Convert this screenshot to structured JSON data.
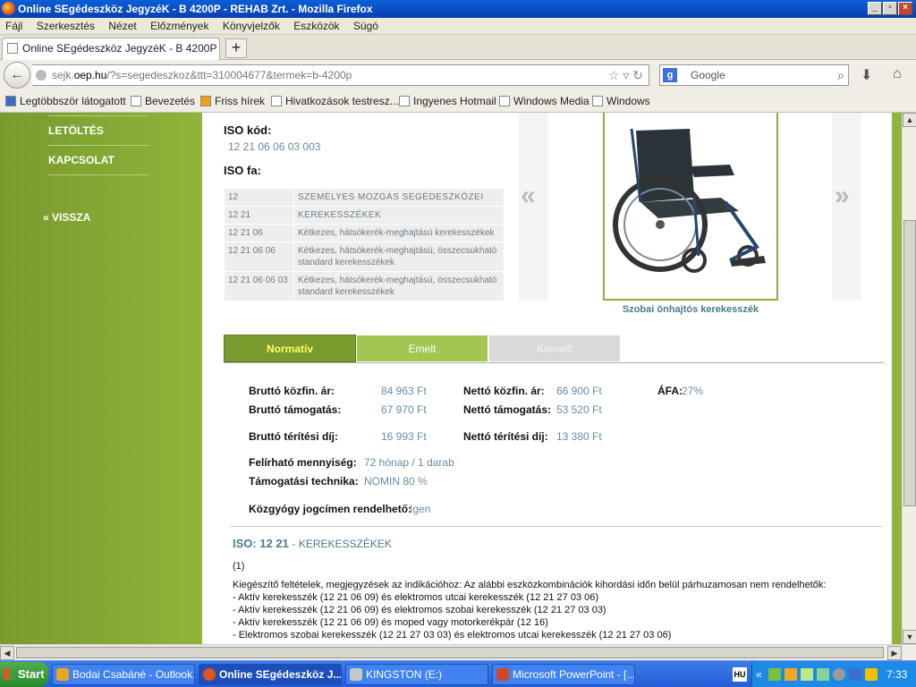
{
  "window": {
    "title": "Online SEgédeszköz JegyzéK - B 4200P - REHAB Zrt. - Mozilla Firefox"
  },
  "menu": [
    "Fájl",
    "Szerkesztés",
    "Nézet",
    "Előzmények",
    "Könyvjelzők",
    "Eszközök",
    "Súgó"
  ],
  "browser_tab": {
    "title": "Online SEgédeszköz JegyzéK - B 4200P - RE...",
    "new_tab": "+"
  },
  "address": {
    "prefix": "sejk.",
    "domain": "oep.hu",
    "path": "/?s=segedeszkoz&ttt=310004677&termek=b-4200p"
  },
  "search": {
    "placeholder": "Google",
    "engine_icon": "g-icon"
  },
  "bookmarks": [
    "Legtöbbször látogatott",
    "Bevezetés",
    "Friss hírek",
    "Hivatkozások testresz...",
    "Ingyenes Hotmail",
    "Windows Media",
    "Windows"
  ],
  "sidebar": {
    "items": [
      "LETÖLTÉS",
      "KAPCSOLAT"
    ],
    "back": "« VISSZA"
  },
  "iso": {
    "code_label": "ISO kód:",
    "code_value": "12 21 06 06 03 003",
    "tree_label": "ISO fa:",
    "tree": [
      {
        "code": "12",
        "name": "SZEMÉLYES MOZGÁS SEGÉDESZKÖZEI"
      },
      {
        "code": "12 21",
        "name": "KEREKESSZÉKEK"
      },
      {
        "code": "12 21 06",
        "name": "Kétkezes, hátsókerék-meghajtású kerekesszékek"
      },
      {
        "code": "12 21 06 06",
        "name": "Kétkezes, hátsókerék-meghajtású, összecsukható standard kerekesszékek"
      },
      {
        "code": "12 21 06 06 03",
        "name": "Kétkezes, hátsókerék-meghajtású, összecsukható standard kerekesszékek"
      }
    ]
  },
  "product": {
    "caption": "Szobai önhajtós kerekesszék",
    "prev": "«",
    "next": "»"
  },
  "price_tabs": [
    "Normatív",
    "Emelt",
    "Kiemelt"
  ],
  "prices": {
    "brutto_kozfin_label": "Bruttó közfin. ár:",
    "brutto_kozfin": "84 963 Ft",
    "netto_kozfin_label": "Nettó közfin. ár:",
    "netto_kozfin": "66 900 Ft",
    "afa_label": "ÁFA:",
    "afa": "27%",
    "brutto_tam_label": "Bruttó támogatás:",
    "brutto_tam": "67 970 Ft",
    "netto_tam_label": "Nettó támogatás:",
    "netto_tam": "53 520 Ft",
    "brutto_terit_label": "Bruttó térítési díj:",
    "brutto_terit": "16 993 Ft",
    "netto_terit_label": "Nettó térítési díj:",
    "netto_terit": "13 380 Ft",
    "mennyiseg_label": "Felírható mennyiség:",
    "mennyiseg": "72 hónap / 1 darab",
    "technika_label": "Támogatási technika:",
    "technika": "NOMIN 80 %",
    "kozgyogy_label": "Közgyógy jogcímen rendelhető:",
    "kozgyogy": "Igen"
  },
  "iso_section": {
    "code": "ISO: 12 21",
    "name": "- KEREKESSZÉKEK",
    "note_num": "(1)"
  },
  "notes": [
    "Kiegészítő feltételek, megjegyzések az indikációhoz: Az alábbi eszközkombinációk kihordási időn belül párhuzamosan nem rendelhetők:",
    "- Aktív kerekesszék (12 21 06 09) és elektromos utcai kerekesszék (12 21 27 03 06)",
    "- Aktív kerekesszék (12 21 06 09) és elektromos szobai kerekesszék (12 21 27 03 03)",
    "- Aktív kerekesszék (12 21 06 09) és moped vagy motorkerékpár (12 16)",
    "- Elektromos szobai kerekesszék (12 21 27 03 03) és elektromos utcai kerekesszék (12 21 27 03 06)"
  ],
  "taskbar": {
    "start": "Start",
    "tasks": [
      "Bodai Csabáné - Outlook...",
      "Online SEgédeszköz J...",
      "KINGSTON (E:)",
      "Microsoft PowerPoint - [..."
    ],
    "lang": "HU",
    "time": "7:33"
  },
  "colors": {
    "sidebar_green": "#8fb43a",
    "tab_normativ": "#7a9a2e",
    "tab_emelt": "#a3c552",
    "tab_kiemelt": "#d9d9d9",
    "value_text": "#6a8aa0"
  }
}
